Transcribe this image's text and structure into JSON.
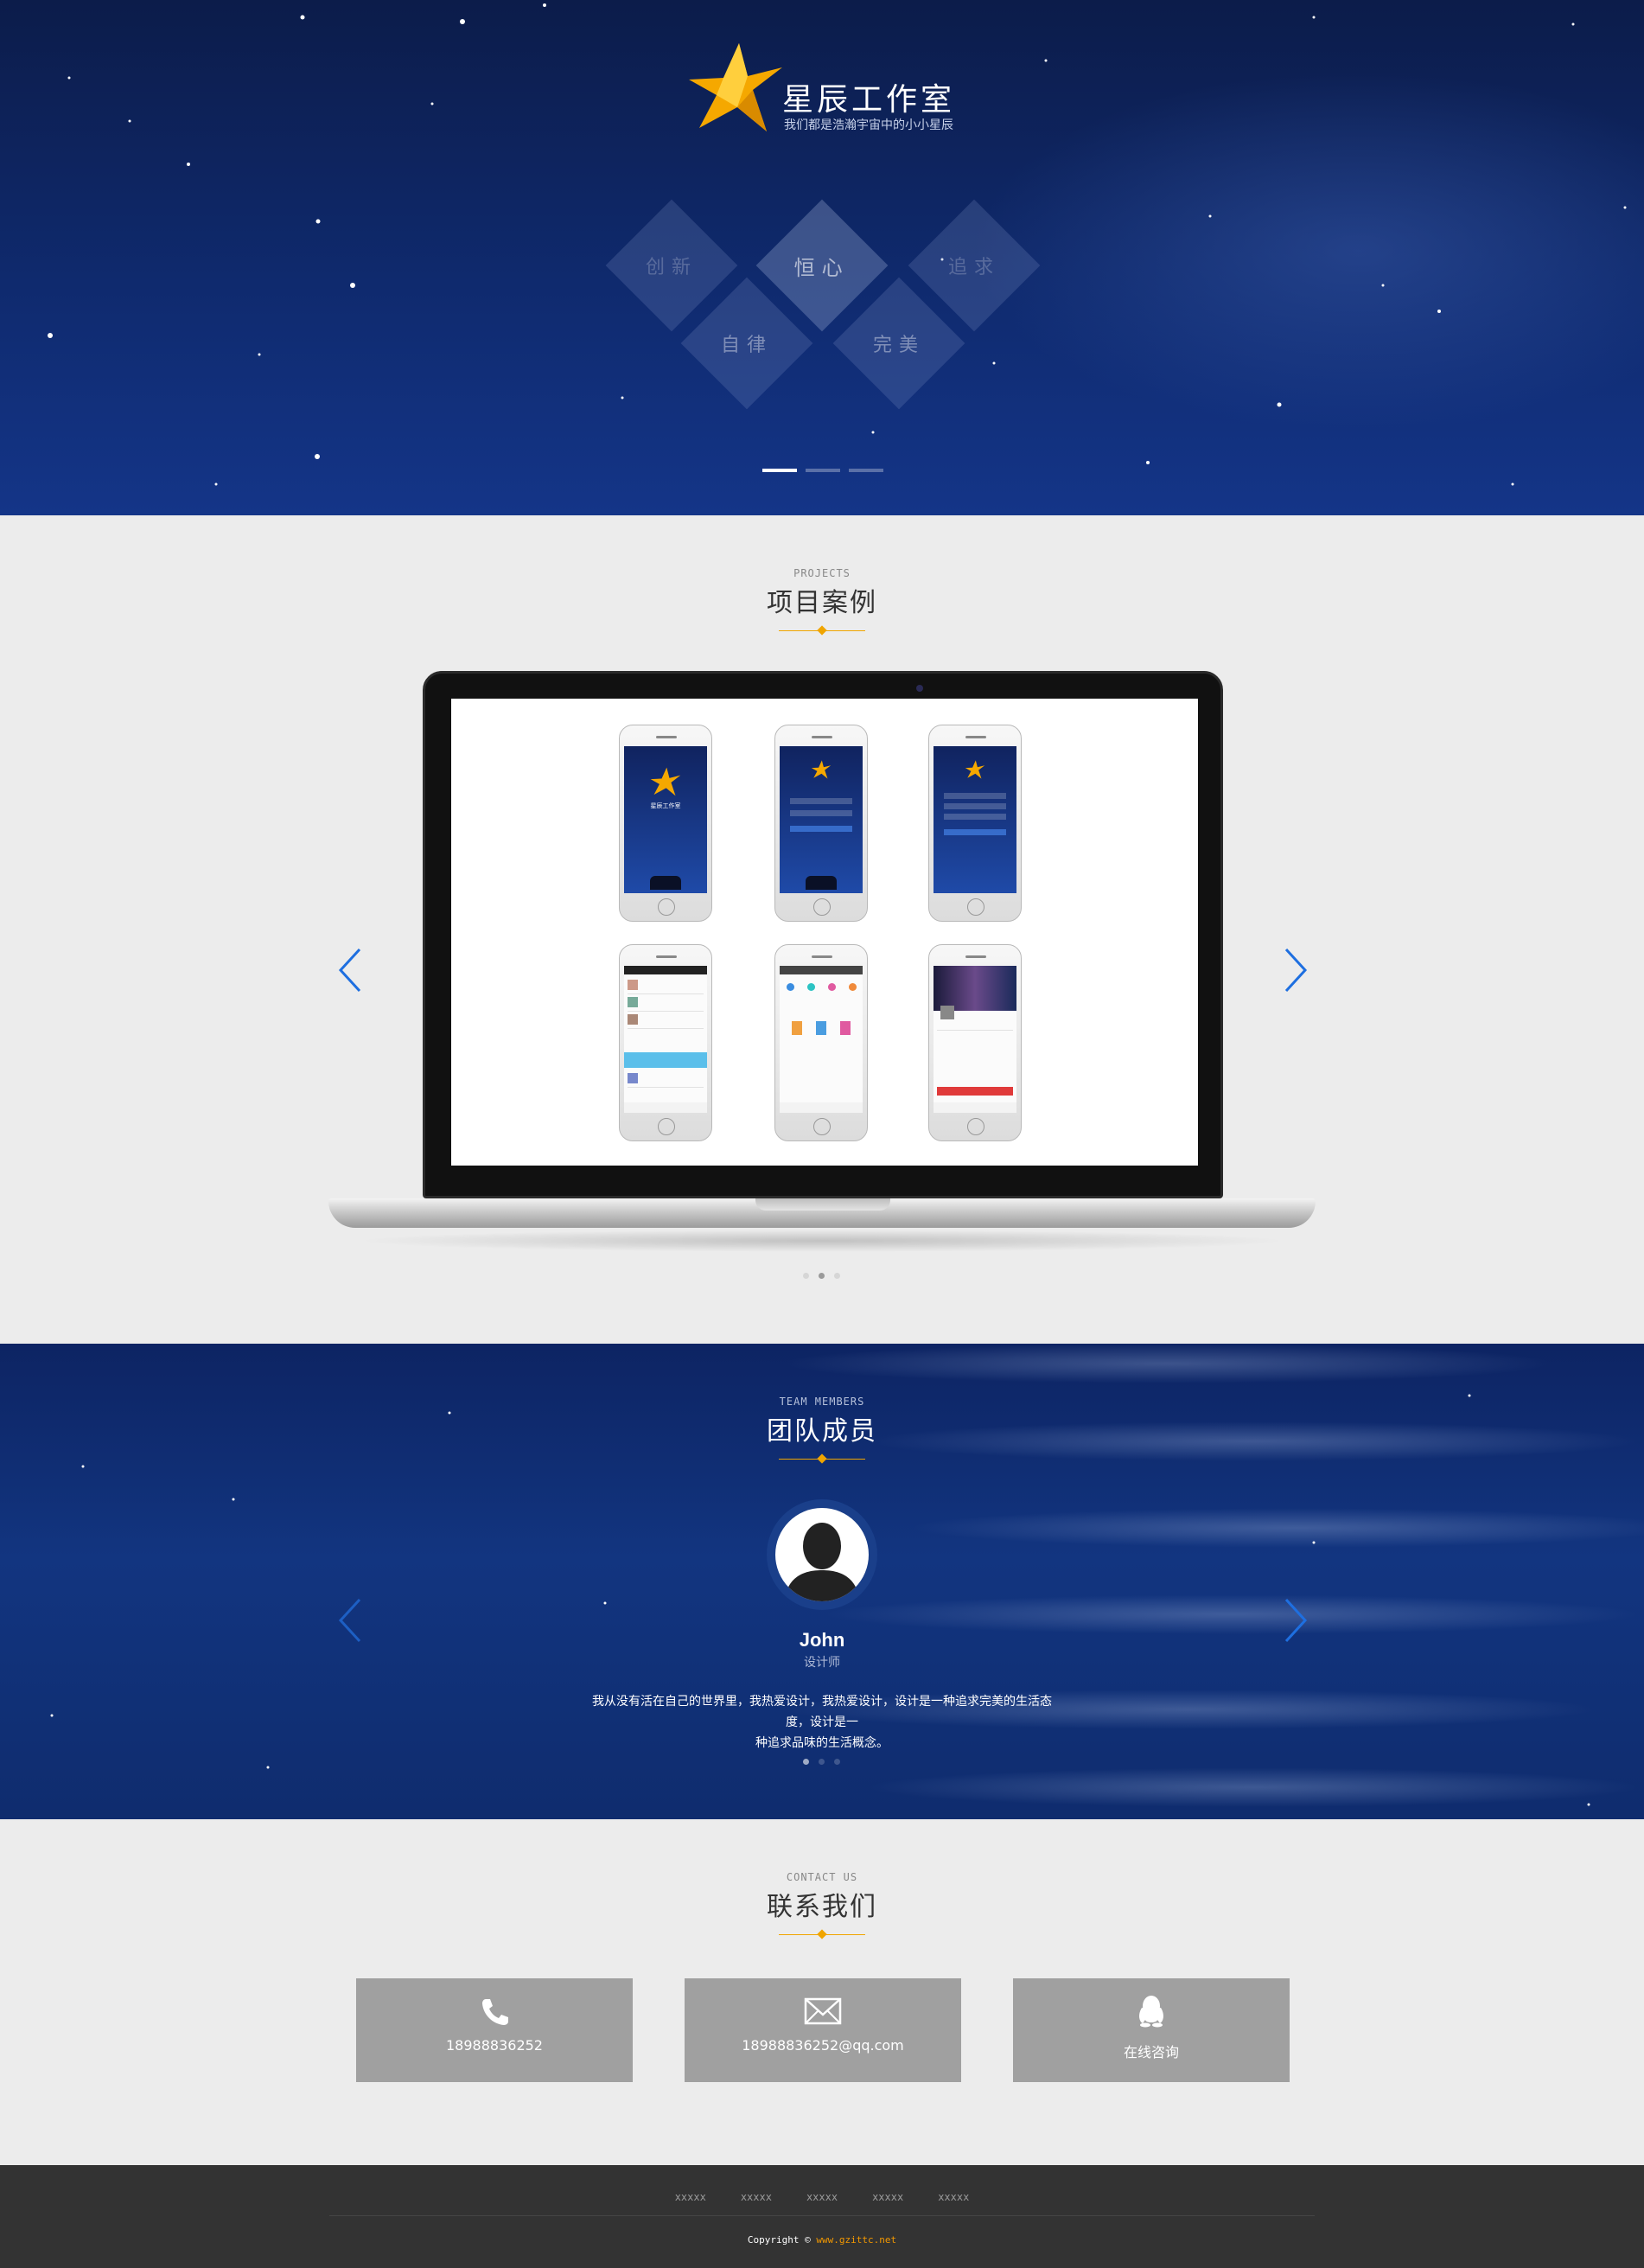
{
  "hero": {
    "brand_name": "星辰工作室",
    "brand_slogan": "我们都是浩瀚宇宙中的小小星辰",
    "values": [
      "创新",
      "恒心",
      "追求",
      "自律",
      "完美"
    ],
    "slides": 3,
    "active_slide": 1
  },
  "projects": {
    "title_en": "PROJECTS",
    "title_cn": "项目案例",
    "phone_splash_title": "星辰工作室",
    "pages": 3,
    "active_page": 2
  },
  "team": {
    "title_en": "TEAM MEMBERS",
    "title_cn": "团队成员",
    "member": {
      "name": "John",
      "role": "设计师",
      "bio_line1": "我从没有活在自己的世界里，我热爱设计，我热爱设计，设计是一种追求完美的生活态度，设计是一",
      "bio_line2": "种追求品味的生活概念。"
    },
    "pages": 3,
    "active_page": 1
  },
  "contact": {
    "title_en": "CONTACT US",
    "title_cn": "联系我们",
    "phone": "18988836252",
    "email": "18988836252@qq.com",
    "online": "在线咨询"
  },
  "footer": {
    "links": [
      "xxxxx",
      "xxxxx",
      "xxxxx",
      "xxxxx",
      "xxxxx"
    ],
    "copyright_prefix": "Copyright ©",
    "site": "www.gzittc.net"
  },
  "colors": {
    "accent": "#f0a500",
    "hero_bg": "#0f2a6e",
    "card_bg": "#a0a0a0",
    "footer_bg": "#333333",
    "arrow": "#1e6fe0"
  }
}
